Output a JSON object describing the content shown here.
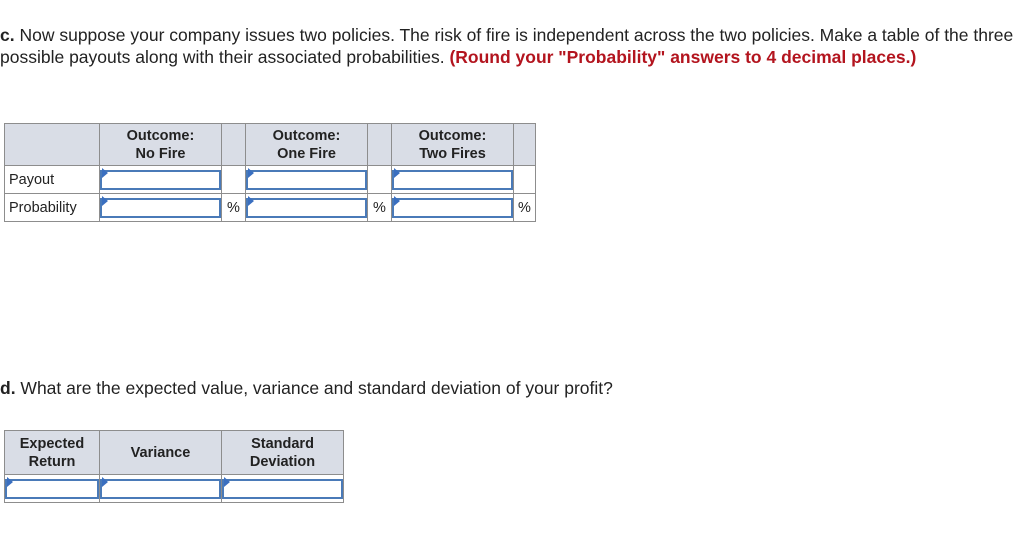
{
  "part_c": {
    "label": "c.",
    "text": " Now suppose your company issues two policies. The risk of fire is independent across the two policies. Make a table of the three possible payouts along with their associated probabilities. ",
    "hint": "(Round your \"Probability\" answers to 4 decimal places.)"
  },
  "table_c": {
    "headers": [
      {
        "line1": "Outcome:",
        "line2": "No Fire"
      },
      {
        "line1": "Outcome:",
        "line2": "One Fire"
      },
      {
        "line1": "Outcome:",
        "line2": "Two Fires"
      }
    ],
    "rows": [
      {
        "label": "Payout",
        "values": [
          "",
          "",
          ""
        ],
        "unit": ""
      },
      {
        "label": "Probability",
        "values": [
          "",
          "",
          ""
        ],
        "unit": "%"
      }
    ]
  },
  "part_d": {
    "label": "d.",
    "text": " What are the expected value, variance and standard deviation of your profit?"
  },
  "table_d": {
    "headers": [
      {
        "line1": "Expected",
        "line2": "Return"
      },
      {
        "line1": "Variance",
        "line2": ""
      },
      {
        "line1": "Standard",
        "line2": "Deviation"
      }
    ],
    "values": [
      "",
      "",
      ""
    ]
  },
  "colors": {
    "hint": "#b3141e",
    "header_bg": "#d9dde6",
    "input_border": "#4a7ab8"
  }
}
